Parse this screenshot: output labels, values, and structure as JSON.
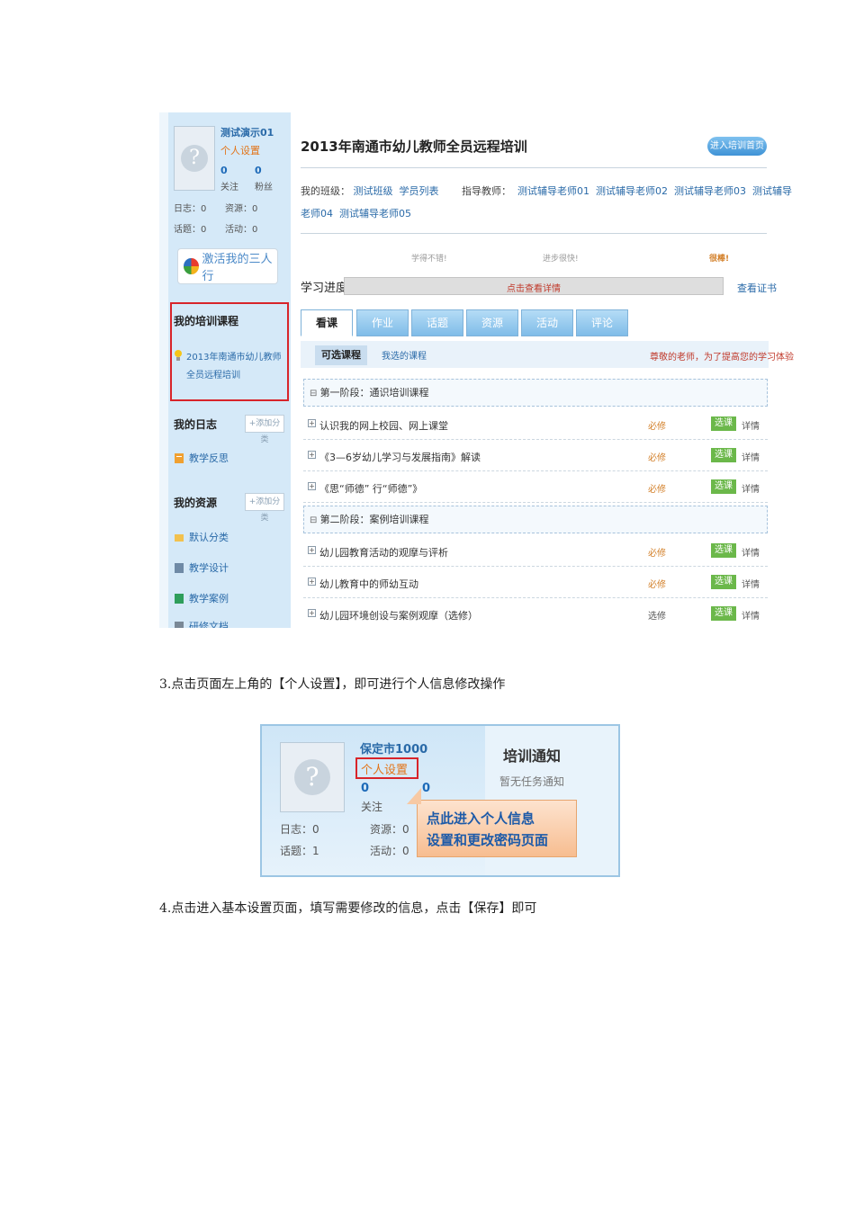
{
  "screenshot1": {
    "user": {
      "name": "测试演示01",
      "settings_link": "个人设置",
      "follow_count": "0",
      "follow_label": "关注",
      "fans_count": "0",
      "fans_label": "粉丝",
      "log": "日志：0",
      "resource": "资源：0",
      "topic": "话题：0",
      "activity": "活动：0"
    },
    "activate_button": "激活我的三人行",
    "my_courses": {
      "heading": "我的培训课程",
      "item": "2013年南通市幼儿教师全员远程培训"
    },
    "my_log": {
      "heading": "我的日志",
      "add": "+添加分类",
      "items": [
        "教学反思"
      ]
    },
    "my_resources": {
      "heading": "我的资源",
      "add": "+添加分类",
      "items": [
        "默认分类",
        "教学设计",
        "教学案例",
        "研修文档"
      ]
    },
    "title": "2013年南通市幼儿教师全员远程培训",
    "enter_button": "进入培训首页",
    "class_label": "我的班级：",
    "class_links": [
      "测试班级",
      "学员列表"
    ],
    "tutor_label": "指导教师：",
    "tutors_line1": [
      "测试辅导老师01",
      "测试辅导老师02",
      "测试辅导老师03",
      "测试辅导"
    ],
    "tutors_line2": [
      "老师04",
      "测试辅导老师05"
    ],
    "progress": {
      "label": "学习进度",
      "milestones": [
        "学得不错!",
        "进步很快!",
        "很棒!"
      ],
      "bar_text": "点击查看详情",
      "certificate": "查看证书"
    },
    "tabs": [
      "看课",
      "作业",
      "话题",
      "资源",
      "活动",
      "评论"
    ],
    "subtabs": {
      "active": "可选课程",
      "other": "我选的课程",
      "notice": "尊敬的老师，为了提高您的学习体验"
    },
    "stages": [
      {
        "name": "第一阶段：通识培训课程",
        "courses": [
          {
            "name": "认识我的网上校园、网上课堂",
            "type": "必修",
            "select": "选课",
            "detail": "详情"
          },
          {
            "name": "《3—6岁幼儿学习与发展指南》解读",
            "type": "必修",
            "select": "选课",
            "detail": "详情"
          },
          {
            "name": "《思“师德” 行“师德”》",
            "type": "必修",
            "select": "选课",
            "detail": "详情"
          }
        ]
      },
      {
        "name": "第二阶段：案例培训课程",
        "courses": [
          {
            "name": "幼儿园教育活动的观摩与评析",
            "type": "必修",
            "select": "选课",
            "detail": "详情"
          },
          {
            "name": "幼儿教育中的师幼互动",
            "type": "必修",
            "select": "选课",
            "detail": "详情"
          },
          {
            "name": "幼儿园环境创设与案例观摩（选修）",
            "type": "选修",
            "select": "选课",
            "detail": "详情"
          }
        ]
      }
    ]
  },
  "step3": "3.点击页面左上角的【个人设置】，即可进行个人信息修改操作",
  "screenshot2": {
    "user": {
      "name": "保定市1000",
      "settings_link": "个人设置",
      "follow_count": "0",
      "fans_count": "0",
      "follow_label": "关注",
      "log": "日志：0",
      "resource": "资源：0",
      "topic": "话题：1",
      "activity": "活动：0"
    },
    "notice_title": "培训通知",
    "notice_text": "暂无任务通知",
    "callout": [
      "点此进入个人信息",
      "设置和更改密码页面"
    ]
  },
  "step4": "4.点击进入基本设置页面，填写需要修改的信息，点击【保存】即可",
  "colors": {
    "highlight_red": "#d8242a",
    "link_blue": "#2a6aa8",
    "select_green": "#6bb84a"
  }
}
